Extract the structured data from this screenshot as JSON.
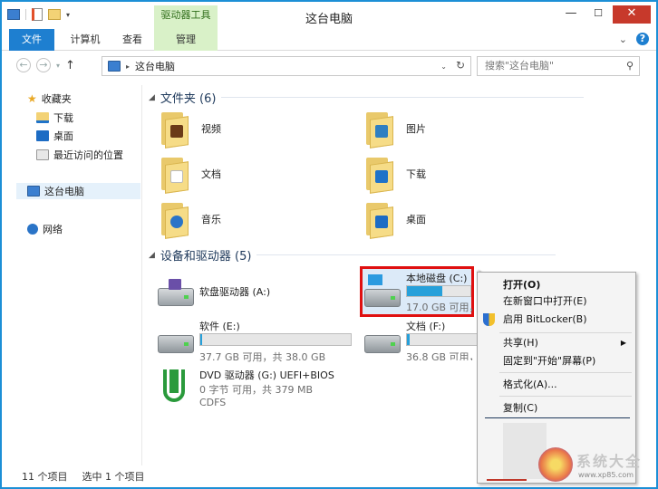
{
  "window": {
    "title": "这台电脑",
    "context_tab": "驱动器工具",
    "minimize": "—",
    "maximize": "☐",
    "close": "✕"
  },
  "ribbon": {
    "tabs": [
      {
        "label": "文件"
      },
      {
        "label": "计算机"
      },
      {
        "label": "查看"
      },
      {
        "label": "管理"
      }
    ],
    "collapse_glyph": "⌄",
    "help_glyph": "?"
  },
  "address": {
    "crumb": "这台电脑",
    "search_placeholder": "搜索\"这台电脑\""
  },
  "nav_pane": {
    "favorites": "收藏夹",
    "favorites_items": [
      "下载",
      "桌面",
      "最近访问的位置"
    ],
    "this_pc": "这台电脑",
    "network": "网络"
  },
  "content": {
    "folders_header": "文件夹 (6)",
    "folders": [
      {
        "label": "视频",
        "badge": "#6b3a17"
      },
      {
        "label": "图片",
        "badge": "#2f7fc1"
      },
      {
        "label": "文档",
        "badge": "#ffffff"
      },
      {
        "label": "下载",
        "badge": "#1f73c9"
      },
      {
        "label": "音乐",
        "badge": "#2a74c7"
      },
      {
        "label": "桌面",
        "badge": "#1d6cc4"
      }
    ],
    "devices_header": "设备和驱动器 (5)",
    "drives": [
      {
        "name": "软盘驱动器 (A:)",
        "size": ""
      },
      {
        "name": "本地磁盘 (C:)",
        "size": "17.0 GB 可用，共",
        "usage": 0.55
      },
      {
        "name": "软件 (E:)",
        "size": "37.7 GB 可用，共 38.0 GB",
        "usage": 0.01
      },
      {
        "name": "文档 (F:)",
        "size": "36.8 GB 可用，共",
        "usage": 0.03
      },
      {
        "name": "DVD 驱动器 (G:) UEFI+BIOS",
        "size": "0 字节 可用，共 379 MB",
        "fs": "CDFS"
      }
    ]
  },
  "context_menu": {
    "items": [
      "打开(O)",
      "在新窗口中打开(E)",
      "启用 BitLocker(B)",
      "共享(H)",
      "固定到\"开始\"屏幕(P)",
      "格式化(A)...",
      "复制(C)"
    ]
  },
  "status": {
    "count": "11 个项目",
    "selected": "选中 1 个项目"
  },
  "watermark": {
    "text": "系统大全",
    "url": "www.xp85.com"
  },
  "colors": {
    "accent": "#1e7fd0",
    "selection_border": "#e01010",
    "drive_bar": "#26a0da"
  }
}
